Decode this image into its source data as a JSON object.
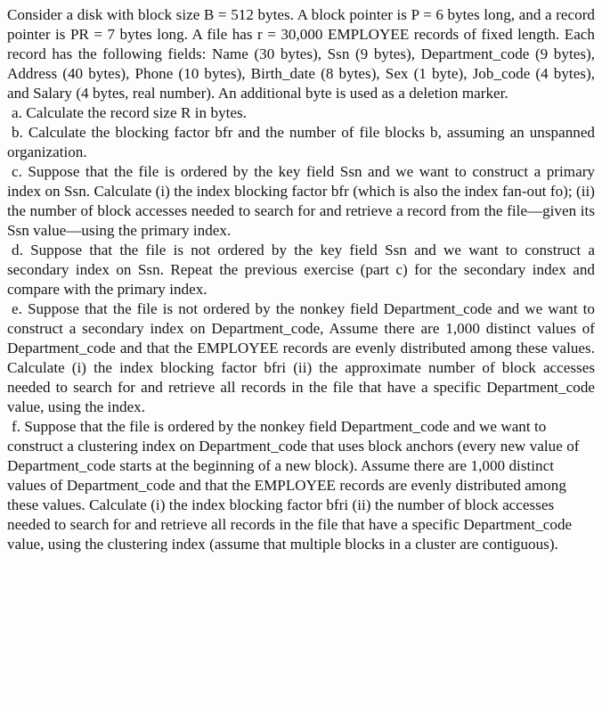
{
  "document": {
    "type": "textbook-exercise",
    "font_style": "serif",
    "text_color": "#161616",
    "background_color": "#fdfdfc",
    "alignment": "justified",
    "paragraphs": [
      {
        "id": "intro",
        "label": "",
        "text": "Consider a disk with block size B = 512 bytes. A block pointer is P = 6 bytes long, and a record pointer is PR = 7 bytes long. A file has r = 30,000 EMPLOYEE records of fixed length. Each record has the following fields: Name (30 bytes), Ssn (9 bytes), Department_code (9 bytes), Address (40 bytes), Phone (10 bytes), Birth_date (8 bytes), Sex (1 byte), Job_code (4 bytes), and Salary (4 bytes, real number). An additional byte is used as a deletion marker."
      },
      {
        "id": "item-a",
        "label": "a.",
        "text": "a. Calculate the record size R in bytes."
      },
      {
        "id": "item-b",
        "label": "b.",
        "text": "b. Calculate the blocking factor bfr and the number of file blocks b, assuming an unspanned organization."
      },
      {
        "id": "item-c",
        "label": "c.",
        "text": "c. Suppose that the file is ordered by the key field Ssn and we want to construct a primary index on Ssn. Calculate (i) the index blocking factor bfr (which is also the index fan-out fo); (ii) the number of block accesses needed to search for and retrieve a record from the file—given its Ssn value—using the primary index."
      },
      {
        "id": "item-d",
        "label": "d.",
        "text": "d. Suppose that the file is not ordered by the key field Ssn and we want to construct a secondary index on Ssn. Repeat the previous exercise (part c) for the secondary index and compare with the primary index."
      },
      {
        "id": "item-e",
        "label": "e.",
        "text": "e. Suppose that the file is not ordered by the nonkey field Department_code and we want to construct a secondary index on Department_code, Assume there are 1,000 distinct values of Department_code and that the EMPLOYEE records are evenly distributed among these values. Calculate (i) the index blocking factor bfri (ii) the approximate number of block accesses needed to search for and retrieve all records in the file that have a specific Department_code value, using the index."
      },
      {
        "id": "item-f",
        "label": "f.",
        "text": "f. Suppose that the file is ordered by the nonkey field Department_code and we want to construct a clustering index on Department_code that uses block anchors (every new value of Department_code starts at the beginning of a new block). Assume there are 1,000 distinct values of Department_code and that the EMPLOYEE records are evenly distributed among these values. Calculate (i) the index blocking factor bfri (ii) the number of block accesses needed to search for and retrieve all records in the file that have a specific Department_code value, using the clustering index (assume that multiple blocks in a cluster are contiguous)."
      }
    ],
    "parameters": {
      "block_size_B": "512 bytes",
      "block_pointer_P": "6 bytes",
      "record_pointer_PR": "7 bytes",
      "record_count_r": "30,000",
      "file_name": "EMPLOYEE",
      "distinct_department_code_values": "1,000",
      "fields": [
        {
          "name": "Name",
          "size": "30 bytes"
        },
        {
          "name": "Ssn",
          "size": "9 bytes"
        },
        {
          "name": "Department_code",
          "size": "9 bytes"
        },
        {
          "name": "Address",
          "size": "40 bytes"
        },
        {
          "name": "Phone",
          "size": "10 bytes"
        },
        {
          "name": "Birth_date",
          "size": "8 bytes"
        },
        {
          "name": "Sex",
          "size": "1 byte"
        },
        {
          "name": "Job_code",
          "size": "4 bytes"
        },
        {
          "name": "Salary",
          "size": "4 bytes, real number"
        },
        {
          "name": "deletion marker",
          "size": "1 additional byte"
        }
      ]
    }
  }
}
